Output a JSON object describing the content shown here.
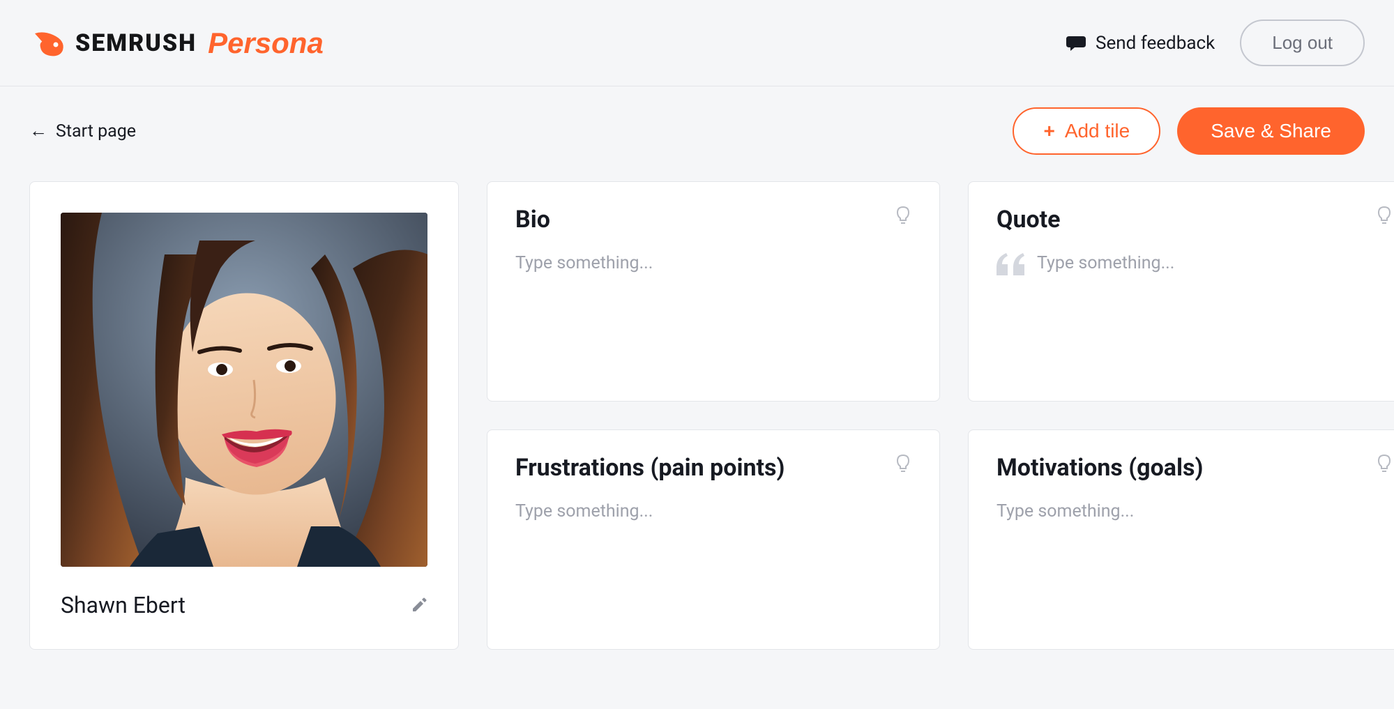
{
  "header": {
    "brand_main": "SEMRUSH",
    "brand_sub": "Persona",
    "feedback_label": "Send feedback",
    "logout_label": "Log out"
  },
  "subheader": {
    "back_label": "Start page",
    "add_tile_label": "Add tile",
    "save_share_label": "Save & Share"
  },
  "persona": {
    "name": "Shawn Ebert"
  },
  "tiles": {
    "bio": {
      "title": "Bio",
      "placeholder": "Type something..."
    },
    "quote": {
      "title": "Quote",
      "placeholder": "Type something..."
    },
    "frustrations": {
      "title": "Frustrations (pain points)",
      "placeholder": "Type something..."
    },
    "motivations": {
      "title": "Motivations (goals)",
      "placeholder": "Type something..."
    }
  }
}
